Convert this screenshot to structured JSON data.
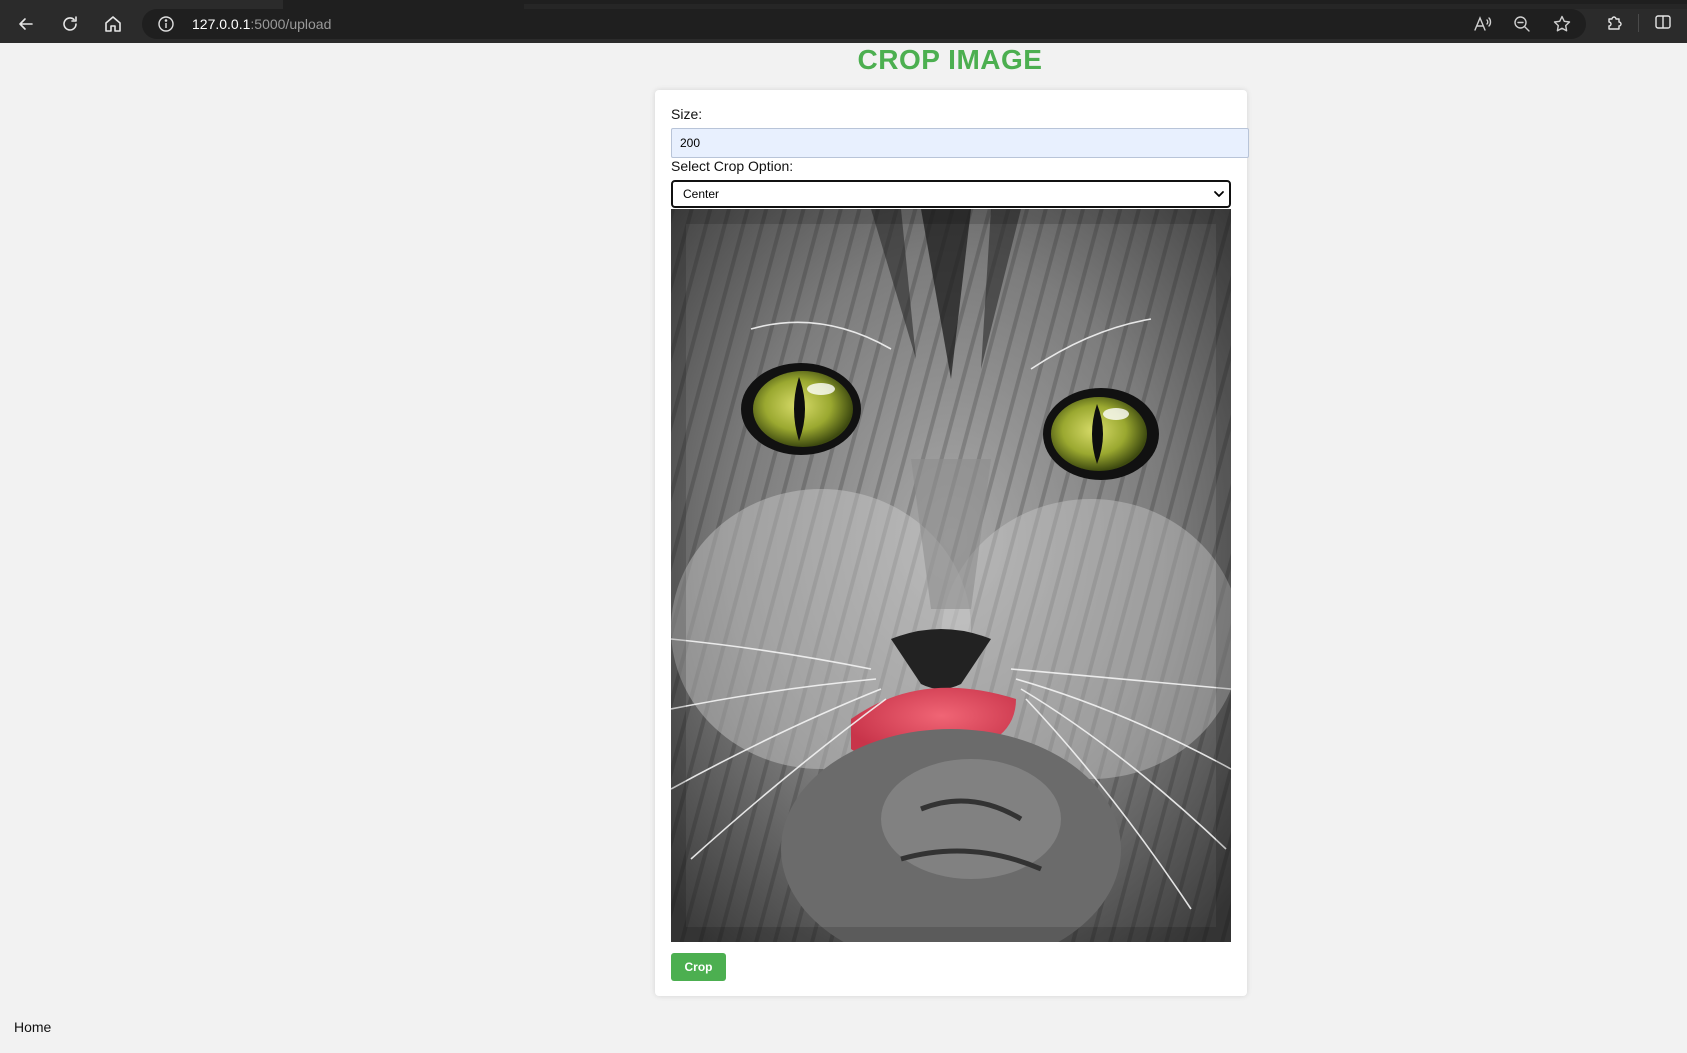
{
  "browser": {
    "url_host": "127.0.0.1",
    "url_path": ":5000/upload"
  },
  "page": {
    "title": "CROP IMAGE"
  },
  "form": {
    "size_label": "Size:",
    "size_value": "200",
    "crop_option_label": "Select Crop Option:",
    "crop_option_selected": "Center",
    "submit_label": "Crop"
  },
  "footer": {
    "home_link": "Home"
  },
  "colors": {
    "accent": "#4caf50",
    "page_bg": "#f2f2f2",
    "chrome_bg": "#2b2b2b"
  }
}
